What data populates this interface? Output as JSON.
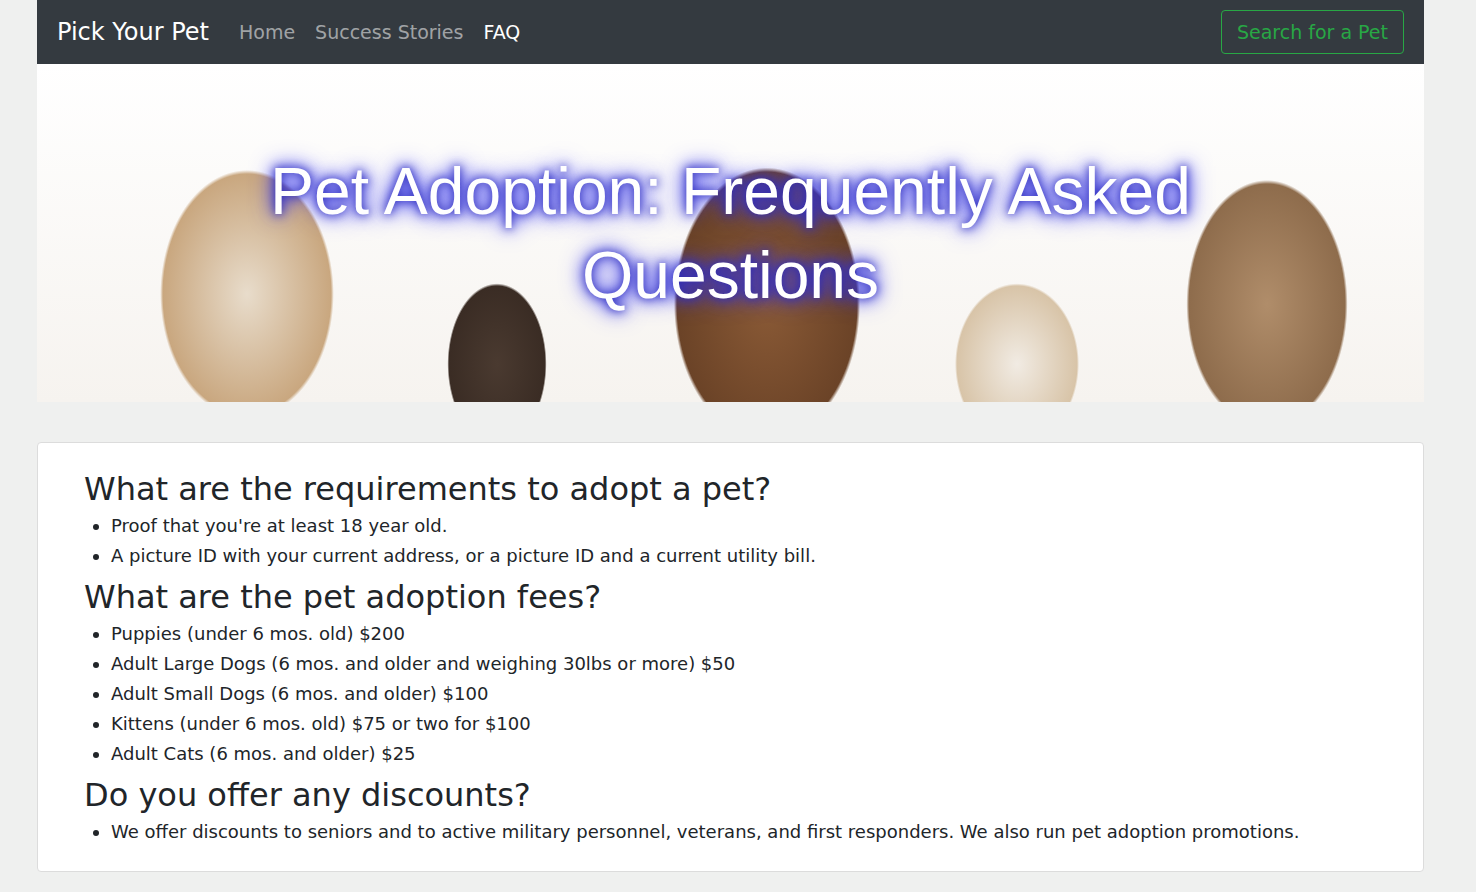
{
  "brand": "Pick Your Pet",
  "nav": [
    {
      "label": "Home",
      "selected": false
    },
    {
      "label": "Success Stories",
      "selected": false
    },
    {
      "label": "FAQ",
      "selected": true
    }
  ],
  "search_button": "Search for a Pet",
  "hero": {
    "title": "Pet Adoption: Frequently Asked Questions"
  },
  "faq": [
    {
      "question": "What are the requirements to adopt a pet?",
      "answers": [
        "Proof that you're at least 18 year old.",
        "A picture ID with your current address, or a picture ID and a current utility bill."
      ]
    },
    {
      "question": "What are the pet adoption fees?",
      "answers": [
        "Puppies (under 6 mos. old) $200",
        "Adult Large Dogs (6 mos. and older and weighing 30lbs or more) $50",
        "Adult Small Dogs (6 mos. and older) $100",
        "Kittens (under 6 mos. old) $75 or two for $100",
        "Adult Cats (6 mos. and older) $25"
      ]
    },
    {
      "question": "Do you offer any discounts?",
      "answers": [
        "We offer discounts to seniors and to active military personnel, veterans, and first responders. We also run pet adoption promotions."
      ]
    }
  ]
}
